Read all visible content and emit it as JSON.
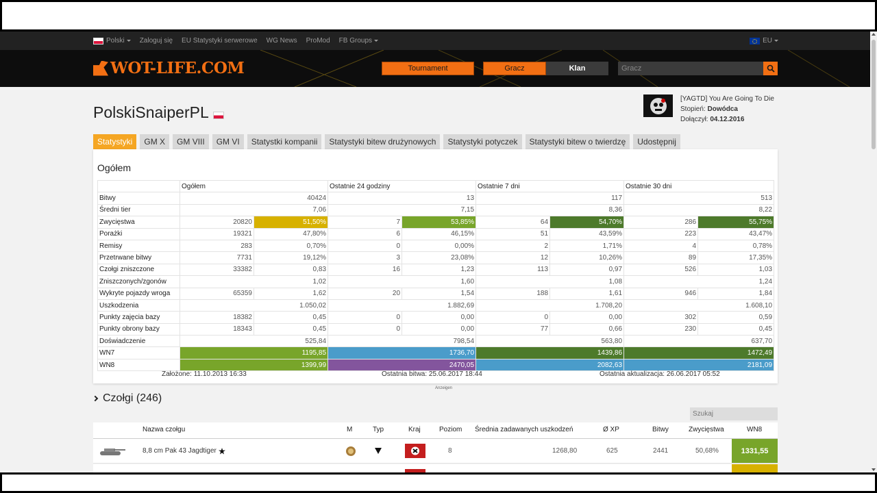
{
  "topnav": {
    "language": "Polski",
    "login": "Zaloguj się",
    "server_stats": "EU Statystyki serwerowe",
    "wg_news": "WG News",
    "promod": "ProMod",
    "fb_groups": "FB Groups",
    "region": "EU"
  },
  "header": {
    "logo": "WOT-LIFE.COM",
    "tournament": "Tournament",
    "player_btn": "Gracz",
    "clan_btn": "Klan",
    "search_placeholder": "Gracz"
  },
  "player": {
    "name": "PolskiSnaiperPL",
    "clan_name": "[YAGTD] You Are Going To Die",
    "rank_label": "Stopień:",
    "rank": "Dowódca",
    "joined_label": "Dołączył:",
    "joined": "04.12.2016"
  },
  "tabs": [
    "Statystyki",
    "GM X",
    "GM VIII",
    "GM VI",
    "Statystki kompanii",
    "Statystyki bitew drużynowych",
    "Statystyki potyczek",
    "Statystyki bitew o twierdzę",
    "Udostępnij"
  ],
  "overview": {
    "title": "Ogółem",
    "columns": [
      "",
      "Ogółem",
      "Ostatnie 24 godziny",
      "Ostatnie 7 dni",
      "Ostatnie 30 dni"
    ],
    "rows": [
      {
        "label": "Bitwy",
        "span": true,
        "cells": [
          "40424",
          "13",
          "117",
          "513"
        ]
      },
      {
        "label": "Średni tier",
        "span": true,
        "cells": [
          "7,06",
          "7,15",
          "8,36",
          "8,22"
        ]
      },
      {
        "label": "Zwycięstwa",
        "span": false,
        "cells": [
          "20820",
          "51,50%",
          "7",
          "53,85%",
          "64",
          "54,70%",
          "286",
          "55,75%"
        ],
        "colors": [
          "",
          "c-yellow",
          "",
          "c-green",
          "",
          "c-dgreen",
          "",
          "c-dgreen"
        ]
      },
      {
        "label": "Porażki",
        "span": false,
        "cells": [
          "19321",
          "47,80%",
          "6",
          "46,15%",
          "51",
          "43,59%",
          "223",
          "43,47%"
        ]
      },
      {
        "label": "Remisy",
        "span": false,
        "cells": [
          "283",
          "0,70%",
          "0",
          "0,00%",
          "2",
          "1,71%",
          "4",
          "0,78%"
        ]
      },
      {
        "label": "Przetrwane bitwy",
        "span": false,
        "cells": [
          "7731",
          "19,12%",
          "3",
          "23,08%",
          "12",
          "10,26%",
          "89",
          "17,35%"
        ]
      },
      {
        "label": "Czołgi zniszczone",
        "span": false,
        "cells": [
          "33382",
          "0,83",
          "16",
          "1,23",
          "113",
          "0,97",
          "526",
          "1,03"
        ]
      },
      {
        "label": "Zniszczonych/zgonów",
        "span": true,
        "cells": [
          "1,02",
          "1,60",
          "1,08",
          "1,24"
        ]
      },
      {
        "label": "Wykryte pojazdy wroga",
        "span": false,
        "cells": [
          "65359",
          "1,62",
          "20",
          "1,54",
          "188",
          "1,61",
          "946",
          "1,84"
        ]
      },
      {
        "label": "Uszkodzenia",
        "span": true,
        "cells": [
          "1.050,02",
          "1.882,69",
          "1.708,20",
          "1.608,10"
        ]
      },
      {
        "label": "Punkty zajęcia bazy",
        "span": false,
        "cells": [
          "18382",
          "0,45",
          "0",
          "0,00",
          "0",
          "0,00",
          "302",
          "0,59"
        ]
      },
      {
        "label": "Punkty obrony bazy",
        "span": false,
        "cells": [
          "18343",
          "0,45",
          "0",
          "0,00",
          "77",
          "0,66",
          "230",
          "0,45"
        ]
      },
      {
        "label": "Doświadczenie",
        "span": true,
        "cells": [
          "525,84",
          "798,54",
          "563,80",
          "637,70"
        ]
      },
      {
        "label": "WN7",
        "span": true,
        "cells": [
          "1195,85",
          "1736,70",
          "1439,86",
          "1472,49"
        ],
        "colors": [
          "c-green",
          "c-blue",
          "c-dgreen",
          "c-dgreen"
        ]
      },
      {
        "label": "WN8",
        "span": true,
        "cells": [
          "1399,99",
          "2470,05",
          "2082,63",
          "2181,09"
        ],
        "colors": [
          "c-green",
          "c-purple",
          "c-blue",
          "c-blue"
        ]
      }
    ],
    "created": "Założone: 11.10.2013 16:33",
    "last_battle": "Ostatnia bitwa: 25.06.2017 18:44",
    "last_update": "Ostatnia aktualizacja: 26.06.2017 05:52"
  },
  "ads_label": "Anzeigen",
  "tanks": {
    "title": "Czołgi (246)",
    "search_placeholder": "Szukaj",
    "headers": {
      "name": "Nazwa czołgu",
      "m": "M",
      "type": "Typ",
      "nation": "Kraj",
      "tier": "Poziom",
      "avg_dmg": "Średnia zadawanych uszkodzeń",
      "xp": "Ø XP",
      "battles": "Bitwy",
      "wins": "Zwycięstwa",
      "wn8": "WN8"
    },
    "rows": [
      {
        "name": "8,8 cm Pak 43 Jagdtiger",
        "tier": "8",
        "avg_dmg": "1268,80",
        "xp": "625",
        "battles": "2441",
        "wins": "50,68%",
        "wn8": "1331,55",
        "wn8_color": "#78a52a"
      }
    ]
  },
  "colors": {
    "accent": "#f26f13",
    "tab_active": "#f5a623",
    "yellow": "#d7b100",
    "green": "#78a52a",
    "dark_green": "#4d7a2b",
    "blue": "#4a9cca",
    "purple": "#83559d"
  }
}
